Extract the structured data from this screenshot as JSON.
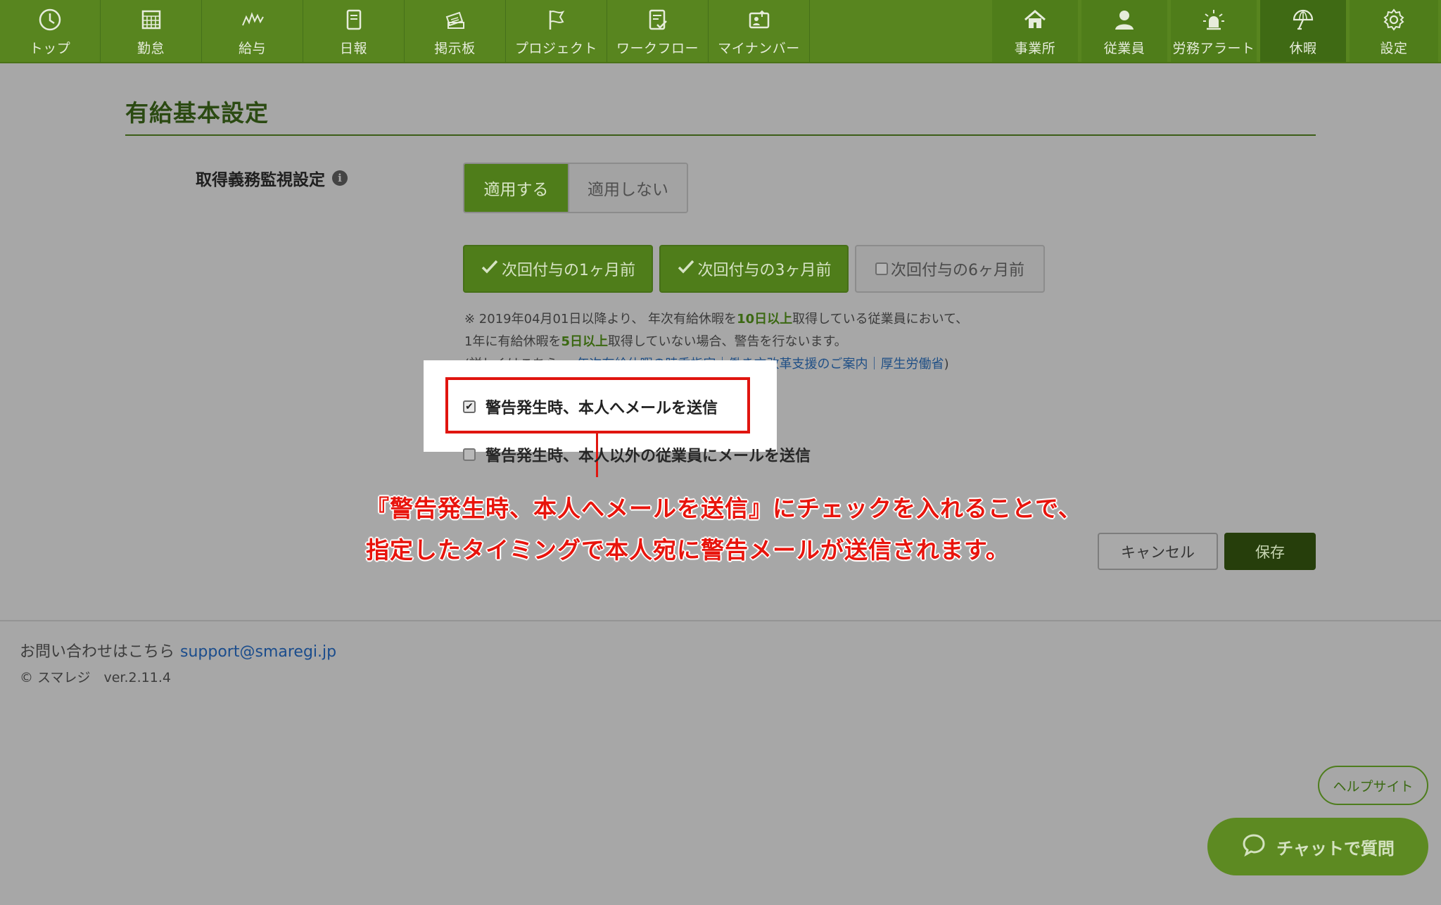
{
  "nav_left": [
    {
      "id": "top",
      "label": "トップ",
      "icon": "clock-icon"
    },
    {
      "id": "attendance",
      "label": "勤怠",
      "icon": "calendar-grid-icon"
    },
    {
      "id": "payroll",
      "label": "給与",
      "icon": "zigzag-chart-icon"
    },
    {
      "id": "daily-report",
      "label": "日報",
      "icon": "notebook-icon"
    },
    {
      "id": "board",
      "label": "掲示板",
      "icon": "board-icon"
    },
    {
      "id": "project",
      "label": "プロジェクト",
      "icon": "flag-icon"
    },
    {
      "id": "workflow",
      "label": "ワークフロー",
      "icon": "document-check-icon"
    },
    {
      "id": "my-number",
      "label": "マイナンバー",
      "icon": "id-card-icon"
    }
  ],
  "nav_right": [
    {
      "id": "office",
      "label": "事業所",
      "icon": "home-icon"
    },
    {
      "id": "employees",
      "label": "従業員",
      "icon": "person-icon"
    },
    {
      "id": "labor-alert",
      "label": "労務アラート",
      "icon": "siren-icon"
    },
    {
      "id": "leave",
      "label": "休暇",
      "icon": "umbrella-icon",
      "active": true
    },
    {
      "id": "settings",
      "label": "設定",
      "icon": "gear-icon"
    }
  ],
  "page": {
    "title": "有給基本設定",
    "field_label": "取得義務監視設定",
    "info_icon_glyph": "i",
    "toggle": {
      "on_label": "適用する",
      "off_label": "適用しない",
      "selected": "on"
    },
    "timing": [
      {
        "label": "次回付与の1ヶ月前",
        "checked": true
      },
      {
        "label": "次回付与の3ヶ月前",
        "checked": true
      },
      {
        "label": "次回付与の6ヶ月前",
        "checked": false
      }
    ],
    "note": {
      "line1_a": "※ 2019年04月01日以降より、 年次有給休暇を",
      "line1_hl": "10日以上",
      "line1_b": "取得している従業員において、",
      "line2_a": "1年に有給休暇を",
      "line2_hl": "5日以上",
      "line2_b": "取得していない場合、警告を行ないます。",
      "line3_a": "(詳しくはこちら ⇒ ",
      "link": "年次有給休暇の時季指定｜働き方改革支援のご案内｜厚生労働省",
      "line3_b": ")"
    },
    "checkbox_self": {
      "label": "警告発生時、本人へメールを送信",
      "checked": true
    },
    "checkbox_others": {
      "label": "警告発生時、本人以外の従業員にメールを送信",
      "checked": false
    },
    "annotation": {
      "line1": "『警告発生時、本人へメールを送信』にチェックを入れることで、",
      "line2": "指定したタイミングで本人宛に警告メールが送信されます。"
    },
    "cancel_label": "キャンセル",
    "save_label": "保存"
  },
  "footer": {
    "contact_text": "お問い合わせはこちら",
    "contact_email": "support@smaregi.jp",
    "copyright": "© スマレジ　ver.2.11.4"
  },
  "help_label": "ヘルプサイト",
  "chat_label": "チャットで質問",
  "colors": {
    "nav_bg": "#58851f",
    "accent": "#4f7d1a",
    "annotation_red": "#e0150f",
    "save_bg": "#263e0b"
  }
}
